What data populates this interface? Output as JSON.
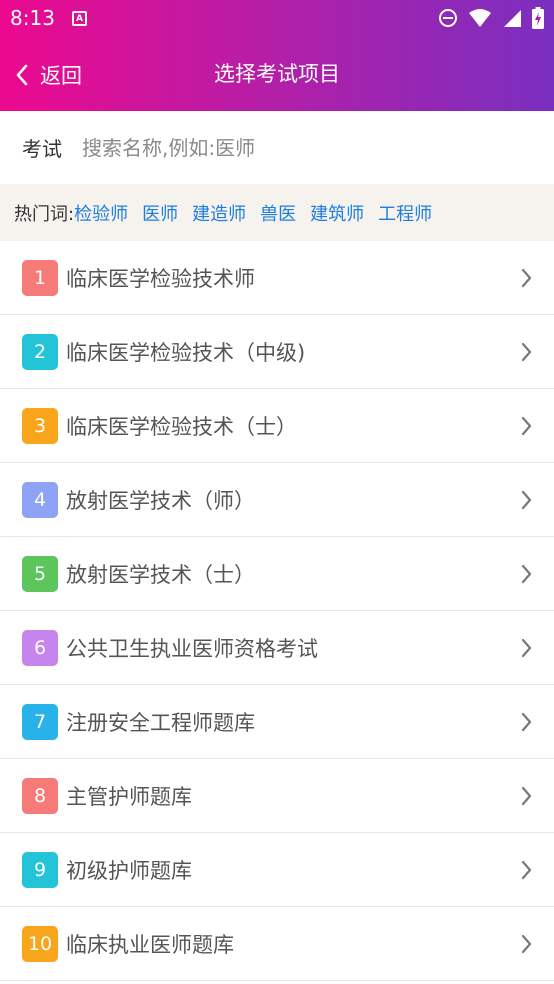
{
  "status_bar": {
    "time": "8:13",
    "notification_badge": "A"
  },
  "titlebar": {
    "back_label": "返回",
    "title": "选择考试项目"
  },
  "search": {
    "label": "考试",
    "placeholder": "搜索名称,例如:医师",
    "value": ""
  },
  "hot_words": {
    "label": "热门词:",
    "tags": [
      "检验师",
      "医师",
      "建造师",
      "兽医",
      "建筑师",
      "工程师"
    ]
  },
  "exams": [
    {
      "num": "1",
      "label": "临床医学检验技术师",
      "color": "#f57a78"
    },
    {
      "num": "2",
      "label": "临床医学检验技术（中级)",
      "color": "#24c4d8"
    },
    {
      "num": "3",
      "label": "临床医学检验技术（士）",
      "color": "#f8a51b"
    },
    {
      "num": "4",
      "label": "放射医学技术（师）",
      "color": "#8ea2f6"
    },
    {
      "num": "5",
      "label": "放射医学技术（士）",
      "color": "#5cc65c"
    },
    {
      "num": "6",
      "label": "公共卫生执业医师资格考试",
      "color": "#c784ef"
    },
    {
      "num": "7",
      "label": "注册安全工程师题库",
      "color": "#27b2ea"
    },
    {
      "num": "8",
      "label": "主管护师题库",
      "color": "#f57a78"
    },
    {
      "num": "9",
      "label": "初级护师题库",
      "color": "#24c4d8"
    },
    {
      "num": "10",
      "label": "临床执业医师题库",
      "color": "#f8a51b"
    }
  ],
  "colors": {
    "header_start": "#ec098f",
    "header_end": "#7a2fc0",
    "link": "#1e7ee0",
    "hot_bg": "#f6f3ee"
  },
  "icons": {
    "back": "chevron-left-icon",
    "row_arrow": "chevron-right-icon",
    "dnd": "do-not-disturb-icon",
    "wifi": "wifi-icon",
    "signal": "signal-icon",
    "battery": "battery-charging-icon"
  }
}
